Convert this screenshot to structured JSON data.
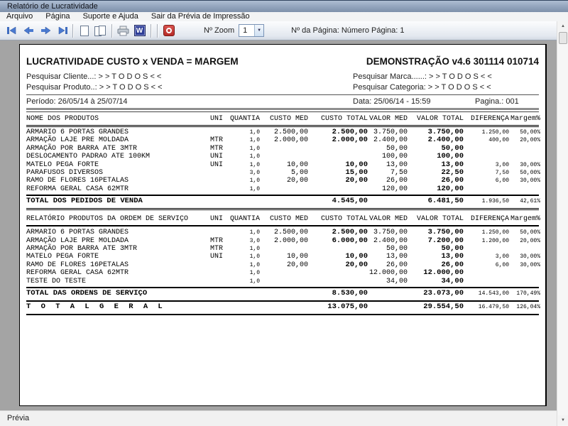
{
  "window": {
    "title": "Relatório de Lucratividade"
  },
  "menu": {
    "items": [
      {
        "label": "Arquivo"
      },
      {
        "label": "Página"
      },
      {
        "label": "Suporte e Ajuda"
      },
      {
        "label": "Sair da Prévia de Impressão"
      }
    ]
  },
  "toolbar": {
    "zoom_label": "Nº Zoom",
    "zoom_value": "1",
    "dropdown_arrow": "▼",
    "page_info": "Nº da Página: Número Página: 1",
    "word_icon_letter": "W"
  },
  "status_bar": {
    "label": "Prévia"
  },
  "scrollbar": {
    "up_arrow": "▲",
    "down_arrow": "▼"
  },
  "report": {
    "title_left": "LUCRATIVIDADE CUSTO x VENDA = MARGEM",
    "title_right": "DEMONSTRAÇÃO v4.6 301114 010714",
    "filter_cliente": "Pesquisar Cliente...: > > T O D O S < <",
    "filter_marca": "Pesquisar Marca......: > > T O D O S < <",
    "filter_produto": "Pesquisar Produto..: > > T O D O S < <",
    "filter_categoria": "Pesquisar Categoria: > > T O D O S < <",
    "periodo": "Período: 26/05/14 à 25/07/14",
    "data_hora": "Data: 25/06/14 - 15:59",
    "pagina": "Pagina.: 001",
    "columns": {
      "uni": "UNI",
      "quantia": "QUANTIA",
      "custo_med": "CUSTO MED",
      "custo_total": "CUSTO TOTAL",
      "valor_med": "VALOR MED",
      "valor_total": "VALOR TOTAL",
      "diferenca": "DIFERENÇA",
      "margem": "Margem%"
    },
    "section1": {
      "name_header": "NOME DOS PRODUTOS",
      "rows": [
        [
          "ARMARIO 6 PORTAS GRANDES",
          "",
          "1,0",
          "2.500,00",
          "2.500,00",
          "3.750,00",
          "3.750,00",
          "1.250,00",
          "50,00%"
        ],
        [
          "ARMAÇÃO LAJE PRE MOLDADA",
          "MTR",
          "1,0",
          "2.000,00",
          "2.000,00",
          "2.400,00",
          "2.400,00",
          "400,00",
          "20,00%"
        ],
        [
          "ARMAÇÃO POR BARRA ATE 3MTR",
          "MTR",
          "1,0",
          "",
          "",
          "50,00",
          "50,00",
          "",
          ""
        ],
        [
          "DESLOCAMENTO PADRAO ATE 100KM",
          "UNI",
          "1,0",
          "",
          "",
          "100,00",
          "100,00",
          "",
          ""
        ],
        [
          "MATELO PEGA FORTE",
          "UNI",
          "1,0",
          "10,00",
          "10,00",
          "13,00",
          "13,00",
          "3,00",
          "30,00%"
        ],
        [
          "PARAFUSOS DIVERSOS",
          "",
          "3,0",
          "5,00",
          "15,00",
          "7,50",
          "22,50",
          "7,50",
          "50,00%"
        ],
        [
          "RAMO DE FLORES 16PETALAS",
          "",
          "1,0",
          "20,00",
          "20,00",
          "26,00",
          "26,00",
          "6,00",
          "30,00%"
        ],
        [
          "REFORMA GERAL CASA 62MTR",
          "",
          "1,0",
          "",
          "",
          "120,00",
          "120,00",
          "",
          ""
        ]
      ],
      "total": {
        "label": "TOTAL DOS PEDIDOS DE VENDA",
        "custo_total": "4.545,00",
        "valor_total": "6.481,50",
        "diferenca": "1.936,50",
        "margem": "42,61%"
      }
    },
    "section2": {
      "name_header": "RELATÓRIO PRODUTOS DA ORDEM DE SERVIÇO",
      "rows": [
        [
          "ARMARIO 6 PORTAS GRANDES",
          "",
          "1,0",
          "2.500,00",
          "2.500,00",
          "3.750,00",
          "3.750,00",
          "1.250,00",
          "50,00%"
        ],
        [
          "ARMAÇÃO LAJE PRE MOLDADA",
          "MTR",
          "3,0",
          "2.000,00",
          "6.000,00",
          "2.400,00",
          "7.200,00",
          "1.200,00",
          "20,00%"
        ],
        [
          "ARMAÇÃO POR BARRA ATE 3MTR",
          "MTR",
          "1,0",
          "",
          "",
          "50,00",
          "50,00",
          "",
          ""
        ],
        [
          "MATELO PEGA FORTE",
          "UNI",
          "1,0",
          "10,00",
          "10,00",
          "13,00",
          "13,00",
          "3,00",
          "30,00%"
        ],
        [
          "RAMO DE FLORES 16PETALAS",
          "",
          "1,0",
          "20,00",
          "20,00",
          "26,00",
          "26,00",
          "6,00",
          "30,00%"
        ],
        [
          "REFORMA GERAL CASA 62MTR",
          "",
          "1,0",
          "",
          "",
          "12.000,00",
          "12.000,00",
          "",
          ""
        ],
        [
          "TESTE DO TESTE",
          "",
          "1,0",
          "",
          "",
          "34,00",
          "34,00",
          "",
          ""
        ]
      ],
      "total": {
        "label": "TOTAL DAS ORDENS DE SERVIÇO",
        "custo_total": "8.530,00",
        "valor_total": "23.073,00",
        "diferenca": "14.543,00",
        "margem": "170,49%"
      }
    },
    "grand_total": {
      "label": "T O T A L   G E R A L",
      "custo_total": "13.075,00",
      "valor_total": "29.554,50",
      "diferenca": "16.479,50",
      "margem": "126,04%"
    }
  }
}
